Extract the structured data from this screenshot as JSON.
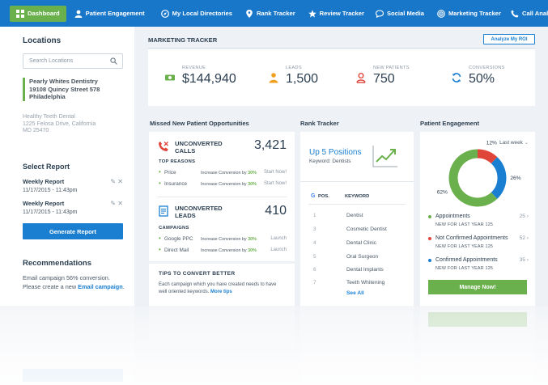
{
  "nav": {
    "items": [
      {
        "label": "Dashboard",
        "icon": "dashboard-icon"
      },
      {
        "label": "Patient Engagement",
        "icon": "user-icon"
      },
      {
        "label": "My Local Directories",
        "icon": "compass-icon"
      },
      {
        "label": "Rank Tracker",
        "icon": "map-pin-icon"
      },
      {
        "label": "Review Tracker",
        "icon": "star-icon"
      },
      {
        "label": "Social Media",
        "icon": "speech-bubble-icon"
      },
      {
        "label": "Marketing Tracker",
        "icon": "target-icon"
      },
      {
        "label": "Call Analysis",
        "icon": "phone-icon"
      }
    ],
    "active_color": "#6ab04c",
    "bar_color": "#1877c9"
  },
  "sidebar": {
    "locations_title": "Locations",
    "search_placeholder": "Search Locations",
    "location_selected": {
      "line1": "Pearly Whites Dentistry",
      "line2": "19108 Quincy Street 578",
      "line3": "Philadelphia"
    },
    "location_other": {
      "line1": "Healthy Teeth Dental",
      "line2": "1225 Felosa Drive, California",
      "line3": "MD 25470"
    },
    "select_report_title": "Select Report",
    "reports": [
      {
        "name": "Weekly Report",
        "date": "11/17/2015 - 11:43pm"
      },
      {
        "name": "Weekly Report",
        "date": "11/17/2015 - 11:43pm"
      }
    ],
    "generate_button": "Generate Report",
    "recommendations_title": "Recommendations",
    "rec_text_1": "Email campaign 56% conversion.",
    "rec_text_2": "Please create a new ",
    "rec_link": "Email campaign",
    "rec_text_3": "."
  },
  "marketing": {
    "title": "MARKETING TRACKER",
    "roi_button": "Analyze My ROI",
    "metrics": [
      {
        "label": "REVENUE",
        "value": "$144,940",
        "icon": "money-icon",
        "color": "#6ab04c"
      },
      {
        "label": "LEADS",
        "value": "1,500",
        "icon": "person-icon",
        "color": "#f0a020"
      },
      {
        "label": "NEW PATIENTS",
        "value": "750",
        "icon": "new-patient-icon",
        "color": "#e0453a"
      },
      {
        "label": "CONVERSIONS",
        "value": "50%",
        "icon": "refresh-icon",
        "color": "#1b7fd1"
      }
    ]
  },
  "missed": {
    "title": "Missed New Patient Opportunities",
    "calls_label_1": "UNCONVERTED",
    "calls_label_2": "CALLS",
    "calls_value": "3,421",
    "top_reasons": "TOP REASONS",
    "reasons": [
      {
        "name": "Price",
        "text": "Increase Conversion by ",
        "pct": "30%",
        "action": "Start Now!"
      },
      {
        "name": "Insurance",
        "text": "Increase Conversion by ",
        "pct": "30%",
        "action": "Start Now!"
      }
    ],
    "leads_label_1": "UNCONVERTED",
    "leads_label_2": "LEADS",
    "leads_value": "410",
    "campaigns": "CAMPAIGNS",
    "campaign_rows": [
      {
        "name": "Google PPC",
        "text": "Increase Conversion by ",
        "pct": "30%",
        "action": "Launch"
      },
      {
        "name": "Direct Mail",
        "text": "Increase Conversion by ",
        "pct": "30%",
        "action": "Launch"
      }
    ],
    "tips_title": "TIPS TO CONVERT BETTER",
    "tips_text_1": "Each campaign which you have created needs to have",
    "tips_text_2": "well oriented keywords. ",
    "tips_link": "More tips"
  },
  "rank": {
    "title": "Rank Tracker",
    "headline": "Up 5 Positions",
    "keyword": "Keyword: Dentists",
    "col_pos": "POS.",
    "col_keyword": "KEYWORD",
    "rows": [
      {
        "pos": "1",
        "keyword": "Dentist"
      },
      {
        "pos": "3",
        "keyword": "Cosmetic Dentist"
      },
      {
        "pos": "4",
        "keyword": "Dental Clinic"
      },
      {
        "pos": "5",
        "keyword": "Oral Surgeon"
      },
      {
        "pos": "6",
        "keyword": "Dental Implants"
      },
      {
        "pos": "7",
        "keyword": "Teeth Whitening"
      }
    ],
    "see_all": "See All"
  },
  "engagement": {
    "title": "Patient Engagement",
    "period": "Last week",
    "chart_data": {
      "type": "pie",
      "categories": [
        "Appointments",
        "Not Confirmed Appointments",
        "Confirmed Appointments"
      ],
      "values": [
        62,
        12,
        26
      ],
      "labels": [
        "62%",
        "12%",
        "26%"
      ],
      "colors": [
        "#6ab04c",
        "#e0453a",
        "#1b7fd1"
      ]
    },
    "legend": [
      {
        "name": "Appointments",
        "value": "25",
        "sub": "NEW FOR LAST YEAR 125",
        "color": "#6ab04c"
      },
      {
        "name": "Not Confirmed Appointments",
        "value": "52",
        "sub": "NEW FOR LAST YEAR 125",
        "color": "#e0453a"
      },
      {
        "name": "Confirmed Appointments",
        "value": "35",
        "sub": "NEW FOR LAST YEAR 125",
        "color": "#1b7fd1"
      }
    ],
    "button": "Manage Now!"
  }
}
